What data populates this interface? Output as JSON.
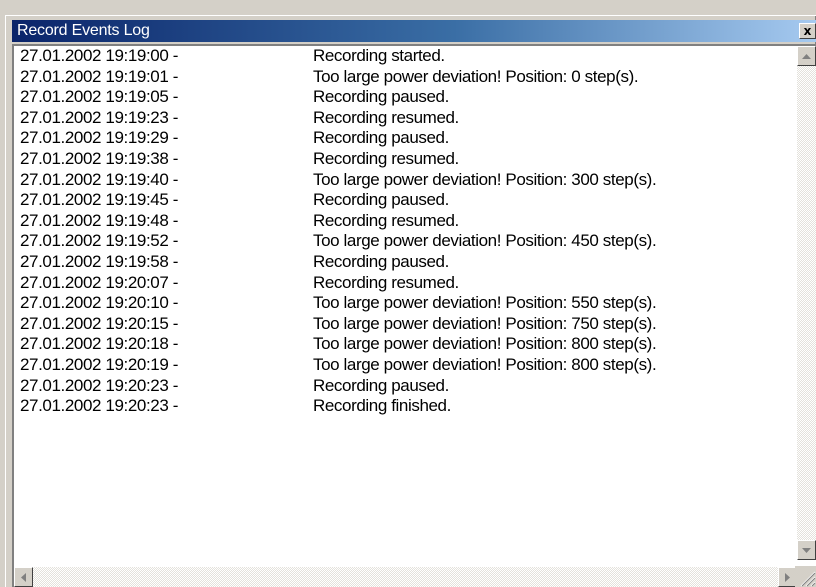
{
  "window": {
    "title": "Record Events Log",
    "close_glyph": "x"
  },
  "icons": {
    "close": "close-icon",
    "scroll_up": "arrow-up-icon",
    "scroll_down": "arrow-down-icon",
    "scroll_left": "arrow-left-icon",
    "scroll_right": "arrow-right-icon",
    "size_grip": "size-grip-icon"
  },
  "colors": {
    "titlebar_start": "#0a246a",
    "titlebar_end": "#a6caf0",
    "face": "#d4d0c8"
  },
  "log": [
    {
      "time": "27.01.2002 19:19:00 -",
      "message": "Recording started."
    },
    {
      "time": "27.01.2002 19:19:01 -",
      "message": "Too large power deviation! Position: 0 step(s)."
    },
    {
      "time": "27.01.2002 19:19:05 -",
      "message": "Recording paused."
    },
    {
      "time": "27.01.2002 19:19:23 -",
      "message": "Recording resumed."
    },
    {
      "time": "27.01.2002 19:19:29 -",
      "message": "Recording paused."
    },
    {
      "time": "27.01.2002 19:19:38 -",
      "message": "Recording resumed."
    },
    {
      "time": "27.01.2002 19:19:40 -",
      "message": "Too large power deviation! Position: 300 step(s)."
    },
    {
      "time": "27.01.2002 19:19:45 -",
      "message": "Recording paused."
    },
    {
      "time": "27.01.2002 19:19:48 -",
      "message": "Recording resumed."
    },
    {
      "time": "27.01.2002 19:19:52 -",
      "message": "Too large power deviation! Position: 450 step(s)."
    },
    {
      "time": "27.01.2002 19:19:58 -",
      "message": "Recording paused."
    },
    {
      "time": "27.01.2002 19:20:07 -",
      "message": "Recording resumed."
    },
    {
      "time": "27.01.2002 19:20:10 -",
      "message": "Too large power deviation! Position: 550 step(s)."
    },
    {
      "time": "27.01.2002 19:20:15 -",
      "message": "Too large power deviation! Position: 750 step(s)."
    },
    {
      "time": "27.01.2002 19:20:18 -",
      "message": "Too large power deviation! Position: 800 step(s)."
    },
    {
      "time": "27.01.2002 19:20:19 -",
      "message": "Too large power deviation! Position: 800 step(s)."
    },
    {
      "time": "27.01.2002 19:20:23 -",
      "message": "Recording paused."
    },
    {
      "time": "27.01.2002 19:20:23 -",
      "message": "Recording finished."
    }
  ]
}
